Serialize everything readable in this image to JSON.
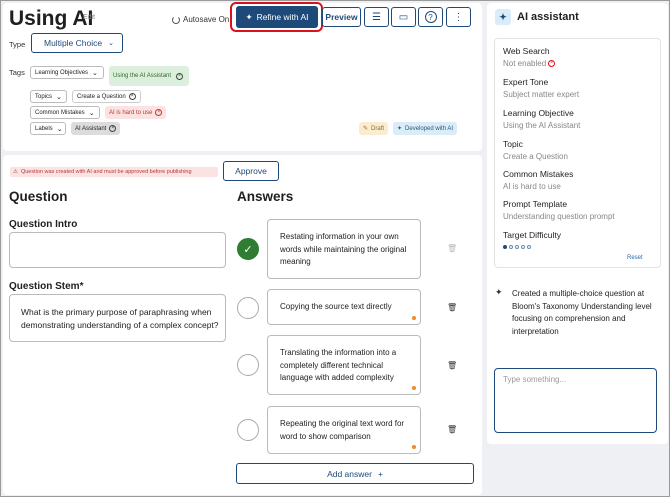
{
  "header": {
    "title": "Using AI",
    "edit_label": "Edit",
    "autosave": "Autosave On",
    "refine": "Refine with AI",
    "preview": "Preview",
    "icons": [
      "list-icon",
      "comment-icon",
      "help-icon",
      "more-icon"
    ]
  },
  "type": {
    "label": "Type",
    "value": "Multiple Choice"
  },
  "tags": {
    "label": "Tags",
    "rows": [
      {
        "select": "Learning Objectives",
        "chip": "Using the AI Assistant"
      },
      {
        "select": "Topics",
        "chip": "Create a Question"
      },
      {
        "select": "Common Mistakes",
        "chip": "AI is hard to use"
      },
      {
        "select": "Labels",
        "chip": "AI Assistant"
      }
    ],
    "draft": "Draft",
    "developed": "Developed with AI"
  },
  "warning": "Question was created with AI and must be approved before publishing",
  "approve": "Approve",
  "question": {
    "heading": "Question",
    "intro_label": "Question Intro",
    "intro_value": "",
    "stem_label": "Question Stem*",
    "stem_value": "What is the primary purpose of paraphrasing when demonstrating understanding of a complex concept?"
  },
  "answers": {
    "heading": "Answers",
    "items": [
      {
        "text": "Restating information in your own words while maintaining the original meaning",
        "correct": true
      },
      {
        "text": "Copying the source text directly",
        "correct": false
      },
      {
        "text": "Translating the information into a completely different technical language with added complexity",
        "correct": false
      },
      {
        "text": "Repeating the original text word for word to show comparison",
        "correct": false
      }
    ],
    "add_label": "Add answer"
  },
  "assistant": {
    "title": "AI assistant",
    "settings": [
      {
        "key": "Web Search",
        "value": "Not enabled"
      },
      {
        "key": "Expert Tone",
        "value": "Subject matter expert"
      },
      {
        "key": "Learning Objective",
        "value": "Using the AI Assistant"
      },
      {
        "key": "Topic",
        "value": "Create a Question"
      },
      {
        "key": "Common Mistakes",
        "value": "AI is hard to use"
      },
      {
        "key": "Prompt Template",
        "value": "Understanding question prompt"
      },
      {
        "key": "Target Difficulty",
        "value": ""
      }
    ],
    "difficulty_level": 1,
    "difficulty_max": 5,
    "reset": "Reset",
    "note": "Created a multiple-choice question at Bloom's Taxonomy Understanding level focusing on comprehension and interpretation",
    "chat_placeholder": "Type something..."
  },
  "colors": {
    "primary": "#1e4a7a",
    "highlight": "#d9121f",
    "correct": "#2e7d32"
  }
}
